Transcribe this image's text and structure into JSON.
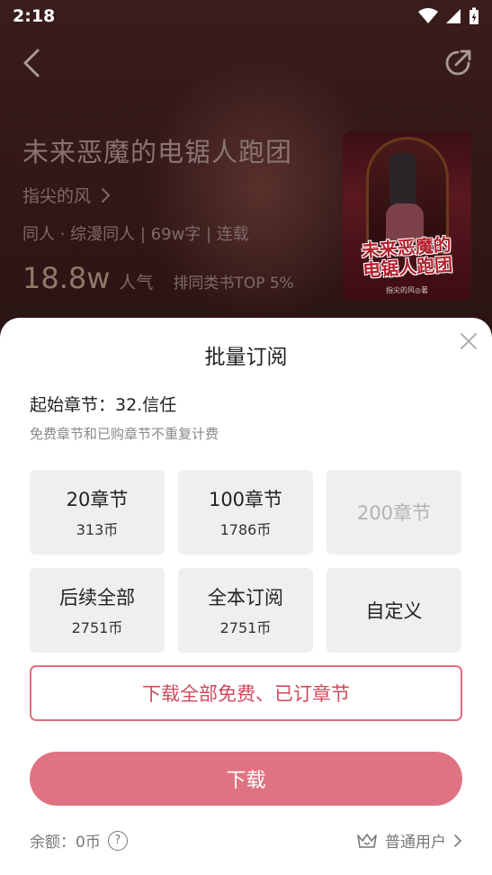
{
  "status_bar": {
    "time": "2:18"
  },
  "book": {
    "title": "未来恶魔的电锯人跑团",
    "author": "指尖的风",
    "meta": "同人 · 综漫同人 | 69w字 | 连载",
    "popularity": "18.8w",
    "popularity_label": "人气",
    "rank": "排同类书TOP 5%",
    "cover_title_line1": "未来恶魔的",
    "cover_title_line2": "电锯人跑团",
    "cover_author": "指尖的风◎著"
  },
  "sheet": {
    "title": "批量订阅",
    "start_chapter": "起始章节：32.信任",
    "free_note": "免费章节和已购章节不重复计费",
    "options": [
      {
        "label": "20章节",
        "price": "313币"
      },
      {
        "label": "100章节",
        "price": "1786币"
      },
      {
        "label": "200章节",
        "price": ""
      },
      {
        "label": "后续全部",
        "price": "2751币"
      },
      {
        "label": "全本订阅",
        "price": "2751币"
      },
      {
        "label": "自定义",
        "price": ""
      }
    ],
    "download_owned_label": "下载全部免费、已订章节",
    "download_label": "下载",
    "balance": "余额：0币",
    "help_glyph": "?",
    "user_level": "普通用户"
  },
  "colors": {
    "accent": "#e07382",
    "accent_text": "#d0485c",
    "sheet_bg": "#ffffff",
    "option_bg": "#efefef"
  }
}
